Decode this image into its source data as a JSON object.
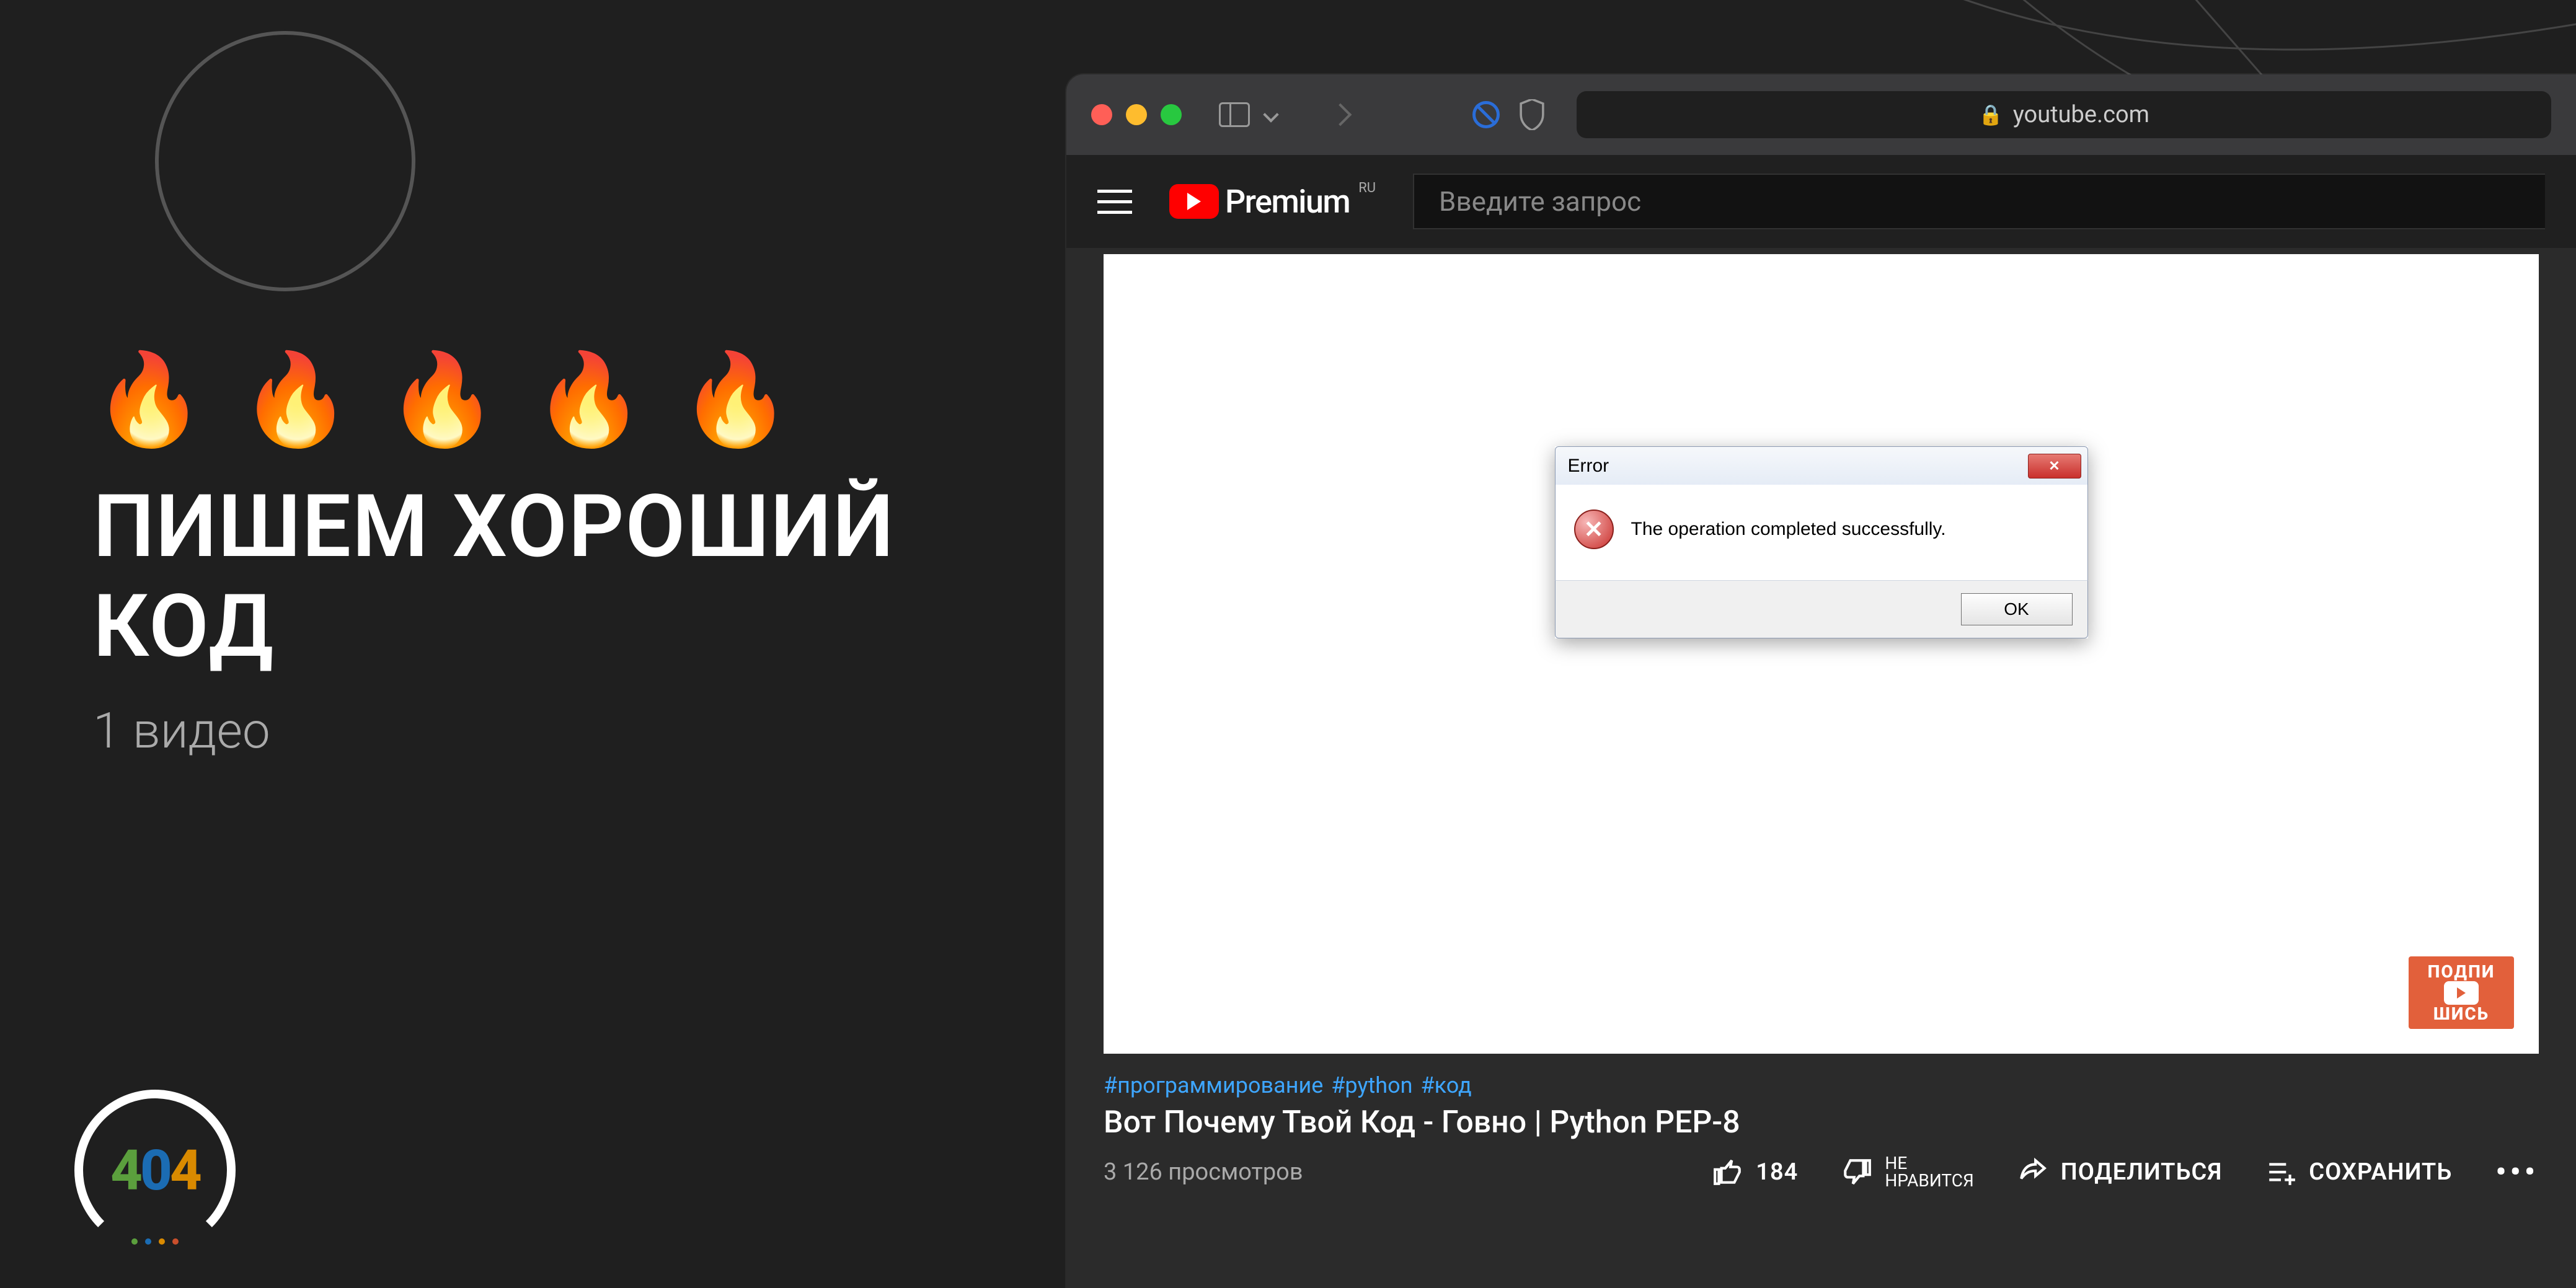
{
  "left": {
    "flames": "🔥 🔥 🔥 🔥 🔥",
    "title_line1": "ПИШЕМ ХОРОШИЙ",
    "title_line2": "КОД",
    "subtitle": "1 видео"
  },
  "badge": {
    "d4a": "4",
    "d0": "0",
    "d4b": "4"
  },
  "safari": {
    "url_host": "youtube.com"
  },
  "youtube": {
    "brand": "Premium",
    "region": "RU",
    "search_placeholder": "Введите запрос"
  },
  "dialog": {
    "title": "Error",
    "message": "The operation completed successfully.",
    "ok": "OK",
    "close": "✕"
  },
  "sticker": {
    "line1": "ПОДПИ",
    "line2": "ШИСЬ"
  },
  "video": {
    "hashtags": [
      "#программирование",
      "#python",
      "#код"
    ],
    "title": "Вот Почему Твой Код - Говно | Python PEP-8",
    "views": "3 126 просмотров",
    "likes": "184",
    "dislike_line1": "НЕ",
    "dislike_line2": "НРАВИТСЯ",
    "share": "ПОДЕЛИТЬСЯ",
    "save": "СОХРАНИТЬ"
  }
}
